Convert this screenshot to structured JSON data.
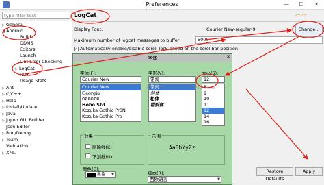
{
  "window": {
    "title": "Preferences",
    "minimize": "—",
    "maximize": "☐",
    "close": "✕"
  },
  "sidebar": {
    "filter_placeholder": "type filter text",
    "items": [
      {
        "label": "General",
        "caret": "▷"
      },
      {
        "label": "Android",
        "caret": "◢"
      },
      {
        "label": "Build",
        "caret": ""
      },
      {
        "label": "DDMS",
        "caret": ""
      },
      {
        "label": "Editors",
        "caret": ""
      },
      {
        "label": "Launch",
        "caret": ""
      },
      {
        "label": "Lint Error Checking",
        "caret": ""
      },
      {
        "label": "LogCat",
        "caret": "▷"
      },
      {
        "label": "NDK",
        "caret": ""
      },
      {
        "label": "Usage Stats",
        "caret": ""
      },
      {
        "label": "Ant",
        "caret": "▷"
      },
      {
        "label": "C/C++",
        "caret": "▷"
      },
      {
        "label": "Help",
        "caret": "▷"
      },
      {
        "label": "Install/Update",
        "caret": "▷"
      },
      {
        "label": "Java",
        "caret": "▷"
      },
      {
        "label": "Jigloo GUI Builder",
        "caret": "▷"
      },
      {
        "label": "Json Editor",
        "caret": ""
      },
      {
        "label": "Run/Debug",
        "caret": "▷"
      },
      {
        "label": "Team",
        "caret": "▷"
      },
      {
        "label": "Validation",
        "caret": ""
      },
      {
        "label": "XML",
        "caret": "▷"
      }
    ]
  },
  "page": {
    "title": "LogCat",
    "nav_back": "⇦",
    "nav_forward": "⇨",
    "display_font_label": "Display Font:",
    "display_font_value": "Courier New-regular-9",
    "change_button": "Change...",
    "max_messages_label": "Maximum number of logcat messages to buffer:",
    "max_messages_value": "5000",
    "autoscroll_checked": "✓",
    "autoscroll_label": "Automatically enable/disable scroll lock based on the scrollbar position",
    "restore_defaults": "Restore Defaults",
    "apply": "Apply"
  },
  "font_dialog": {
    "title": "字体",
    "close": "✕",
    "font_label": "字体(F):",
    "font_value": "Courier New",
    "fonts": [
      "Courier New",
      "Georgia",
      "ดดดดดด",
      "Hobo Std",
      "Kozuka Gothic Pr6N",
      "Kozuka Gothic Pro"
    ],
    "style_label": "字形(Y):",
    "style_value": "常规",
    "styles": [
      "常规",
      "斜体",
      "粗体",
      "粗斜体"
    ],
    "size_label": "大小(S):",
    "size_value": "12",
    "sizes": [
      "8",
      "9",
      "10",
      "11",
      "12",
      "14",
      "16"
    ],
    "effects_label": "效果",
    "strikeout_label": "删除线(K)",
    "underline_label": "下划线(U)",
    "color_label": "颜色(C):",
    "color_value": "黑色",
    "sample_label": "示例",
    "sample_text": "AaBbYyZz",
    "script_label": "脚本(R):",
    "script_value": "西欧语言",
    "watermark": "http://blog.csdn.net/6012 9895"
  },
  "colors": {
    "annotation": "#e0201a",
    "dialog_bg": "#a8d8a8",
    "selection": "#3a7bd5"
  }
}
